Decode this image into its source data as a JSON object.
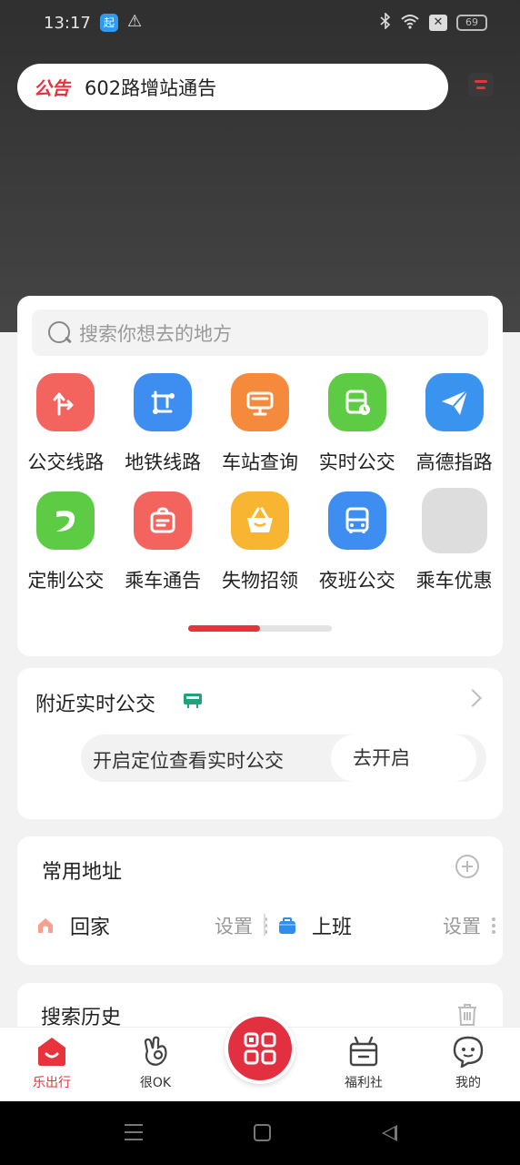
{
  "status_bar": {
    "time": "13:17",
    "app_badge": "起",
    "battery": "69"
  },
  "notice": {
    "badge": "公告",
    "text": "602路增站通告"
  },
  "search": {
    "placeholder": "搜索你想去的地方"
  },
  "services": [
    {
      "label": "公交线路",
      "icon": "bus-route-icon",
      "color": "#f3645e"
    },
    {
      "label": "地铁线路",
      "icon": "metro-icon",
      "color": "#3d8ef0"
    },
    {
      "label": "车站查询",
      "icon": "station-icon",
      "color": "#f58a3c"
    },
    {
      "label": "实时公交",
      "icon": "realtime-bus-icon",
      "color": "#5ecb45"
    },
    {
      "label": "高德指路",
      "icon": "paper-plane-icon",
      "color": "#3b93f0"
    },
    {
      "label": "定制公交",
      "icon": "custom-bus-icon",
      "color": "#5ecb45"
    },
    {
      "label": "乘车通告",
      "icon": "notice-bag-icon",
      "color": "#f3645e"
    },
    {
      "label": "失物招领",
      "icon": "basket-icon",
      "color": "#f7b531"
    },
    {
      "label": "夜班公交",
      "icon": "night-bus-icon",
      "color": "#3d8ef0"
    },
    {
      "label": "乘车优惠",
      "icon": "placeholder-icon",
      "color": "#dddddd"
    }
  ],
  "pager": {
    "progress": 0.5
  },
  "nearby": {
    "title": "附近实时公交",
    "location_prompt": "开启定位查看实时公交",
    "enable_button": "去开启"
  },
  "addresses": {
    "title": "常用地址",
    "home_label": "回家",
    "work_label": "上班",
    "set_label": "设置"
  },
  "history": {
    "title": "搜索历史"
  },
  "tabs": [
    {
      "label": "乐出行",
      "icon": "home-smile-icon"
    },
    {
      "label": "很OK",
      "icon": "hand-ok-icon"
    },
    {
      "label": "福利社",
      "icon": "gift-box-icon"
    },
    {
      "label": "我的",
      "icon": "chat-face-icon"
    }
  ],
  "colors": {
    "accent": "#e8323c"
  }
}
